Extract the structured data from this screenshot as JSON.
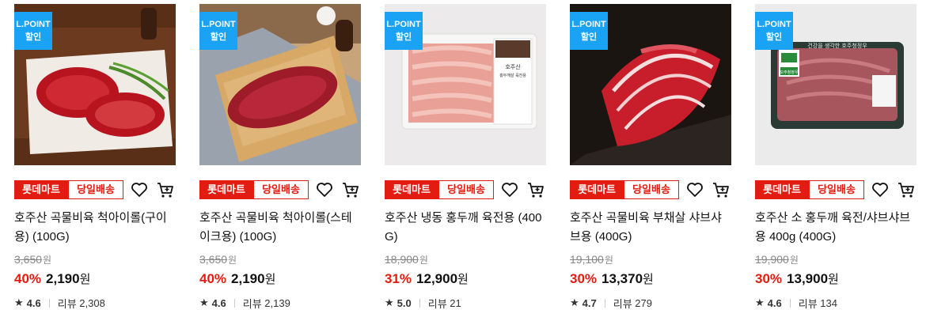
{
  "products": [
    {
      "badge_top": "L.POINT",
      "badge_bottom": "할인",
      "store": "롯데마트",
      "delivery": "당일배송",
      "name": "호주산 곡물비육 척아이롤(구이용) (100G)",
      "original_price": "3,650",
      "currency_small": "원",
      "discount": "40%",
      "price": "2,190",
      "currency": "원",
      "rating": "4.6",
      "review_label": "리뷰",
      "review_count": "2,308"
    },
    {
      "badge_top": "L.POINT",
      "badge_bottom": "할인",
      "store": "롯데마트",
      "delivery": "당일배송",
      "name": "호주산 곡물비육 척아이롤(스테이크용) (100G)",
      "original_price": "3,650",
      "currency_small": "원",
      "discount": "40%",
      "price": "2,190",
      "currency": "원",
      "rating": "4.6",
      "review_label": "리뷰",
      "review_count": "2,139"
    },
    {
      "badge_top": "L.POINT",
      "badge_bottom": "할인",
      "store": "롯데마트",
      "delivery": "당일배송",
      "name": "호주산 냉동 홍두깨 육전용 (400G)",
      "original_price": "18,900",
      "currency_small": "원",
      "discount": "31%",
      "price": "12,900",
      "currency": "원",
      "rating": "5.0",
      "review_label": "리뷰",
      "review_count": "21",
      "package_text": [
        "호주산",
        "홍두깨살 육전용"
      ]
    },
    {
      "badge_top": "L.POINT",
      "badge_bottom": "할인",
      "store": "롯데마트",
      "delivery": "당일배송",
      "name": "호주산 곡물비육 부채살 샤브샤브용 (400G)",
      "original_price": "19,100",
      "currency_small": "원",
      "discount": "30%",
      "price": "13,370",
      "currency": "원",
      "rating": "4.7",
      "review_label": "리뷰",
      "review_count": "279"
    },
    {
      "badge_top": "L.POINT",
      "badge_bottom": "할인",
      "store": "롯데마트",
      "delivery": "당일배송",
      "name": "호주산 소 홍두깨 육전/샤브샤브용 400g (400G)",
      "original_price": "19,900",
      "currency_small": "원",
      "discount": "30%",
      "price": "13,900",
      "currency": "원",
      "rating": "4.6",
      "review_label": "리뷰",
      "review_count": "134",
      "package_text": [
        "건강을 생각한 호주청정우",
        "오주청정우"
      ]
    }
  ],
  "colors": {
    "accent_red": "#e21c10",
    "lpoint_blue": "#1aa3f4"
  },
  "icons": {
    "wishlist": "heart-icon",
    "cart": "cart-icon",
    "rating": "star-icon"
  }
}
